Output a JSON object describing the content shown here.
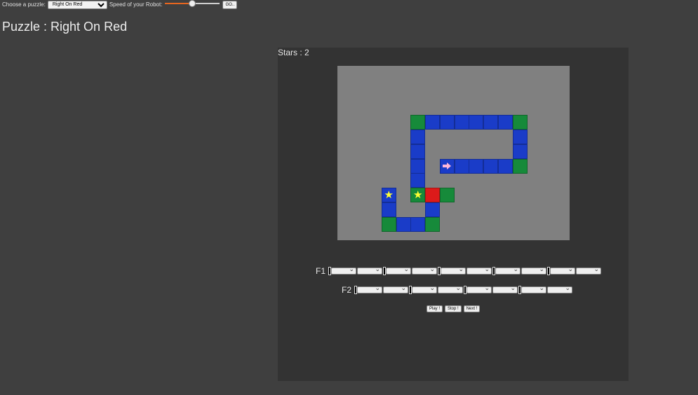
{
  "toolbar": {
    "choose_label": "Choose a puzzle:",
    "puzzle_value": "Right On Red",
    "speed_label": "Speed of your Robot:",
    "speed_fraction": 0.5,
    "go_label": "GO.."
  },
  "page": {
    "title": "Puzzle : Right On Red"
  },
  "game": {
    "stars_text": "Stars : 2",
    "colors": {
      "blue": "#1a3cc8",
      "green": "#168a3a",
      "red": "#dc1a1a",
      "board": "#808080",
      "star": "#ffff33",
      "robot": "#ffb6d9"
    },
    "tiles": [
      {
        "c": 5,
        "r": 3,
        "color": "green"
      },
      {
        "c": 6,
        "r": 3,
        "color": "blue"
      },
      {
        "c": 7,
        "r": 3,
        "color": "blue"
      },
      {
        "c": 8,
        "r": 3,
        "color": "blue"
      },
      {
        "c": 9,
        "r": 3,
        "color": "blue"
      },
      {
        "c": 10,
        "r": 3,
        "color": "blue"
      },
      {
        "c": 11,
        "r": 3,
        "color": "blue"
      },
      {
        "c": 12,
        "r": 3,
        "color": "green"
      },
      {
        "c": 5,
        "r": 4,
        "color": "blue"
      },
      {
        "c": 12,
        "r": 4,
        "color": "blue"
      },
      {
        "c": 5,
        "r": 5,
        "color": "blue"
      },
      {
        "c": 12,
        "r": 5,
        "color": "blue"
      },
      {
        "c": 5,
        "r": 6,
        "color": "blue"
      },
      {
        "c": 7,
        "r": 6,
        "color": "blue"
      },
      {
        "c": 8,
        "r": 6,
        "color": "blue"
      },
      {
        "c": 9,
        "r": 6,
        "color": "blue"
      },
      {
        "c": 10,
        "r": 6,
        "color": "blue"
      },
      {
        "c": 11,
        "r": 6,
        "color": "blue"
      },
      {
        "c": 12,
        "r": 6,
        "color": "green"
      },
      {
        "c": 5,
        "r": 7,
        "color": "blue"
      },
      {
        "c": 3,
        "r": 8,
        "color": "blue"
      },
      {
        "c": 5,
        "r": 8,
        "color": "green"
      },
      {
        "c": 6,
        "r": 8,
        "color": "red"
      },
      {
        "c": 7,
        "r": 8,
        "color": "green"
      },
      {
        "c": 3,
        "r": 9,
        "color": "blue"
      },
      {
        "c": 6,
        "r": 9,
        "color": "blue"
      },
      {
        "c": 3,
        "r": 10,
        "color": "green"
      },
      {
        "c": 4,
        "r": 10,
        "color": "blue"
      },
      {
        "c": 5,
        "r": 10,
        "color": "blue"
      },
      {
        "c": 6,
        "r": 10,
        "color": "green"
      }
    ],
    "stars": [
      {
        "c": 3,
        "r": 8
      },
      {
        "c": 5,
        "r": 8
      }
    ],
    "robot": {
      "c": 7,
      "r": 6,
      "facing": "right"
    }
  },
  "functions": [
    {
      "label": "F1",
      "slots": 10,
      "markers": [
        0,
        2,
        4,
        6,
        8
      ]
    },
    {
      "label": "F2",
      "slots": 8,
      "markers": [
        0,
        2,
        4,
        6
      ]
    }
  ],
  "controls": {
    "play": "Play !",
    "stop": "Stop !",
    "next": "Next !"
  }
}
